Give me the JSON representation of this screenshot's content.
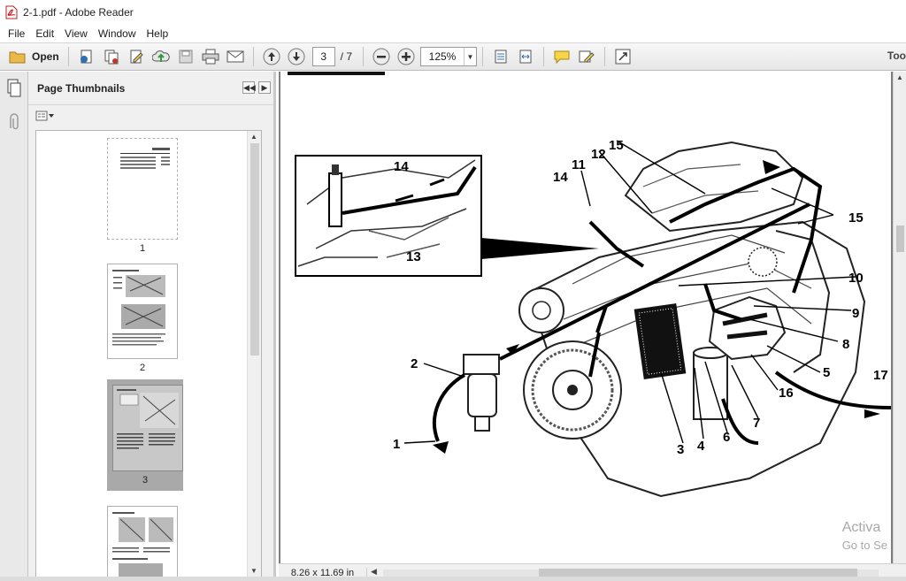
{
  "window": {
    "title": "2-1.pdf - Adobe Reader"
  },
  "menu": [
    "File",
    "Edit",
    "View",
    "Window",
    "Help"
  ],
  "toolbar": {
    "open_label": "Open",
    "current_page": "3",
    "total_pages": "/ 7",
    "zoom": "125%",
    "tools_label": "Too"
  },
  "panel": {
    "title": "Page Thumbnails",
    "thumbnails": [
      {
        "label": "1"
      },
      {
        "label": "2"
      },
      {
        "label": "3",
        "selected": true
      },
      {
        "label": ""
      }
    ]
  },
  "document": {
    "callouts": [
      "1",
      "2",
      "3",
      "4",
      "5",
      "6",
      "7",
      "8",
      "9",
      "10",
      "11",
      "12",
      "13",
      "14",
      "14",
      "15",
      "15",
      "16",
      "17"
    ],
    "page_size": "8.26 x 11.69 in",
    "watermark": {
      "line1": "Activa",
      "line2": "Go to Se"
    }
  },
  "colors": {
    "toolbar": "#e9e9e9",
    "canvas": "#7e7e7e",
    "selected_thumb": "#a9a9a9"
  }
}
